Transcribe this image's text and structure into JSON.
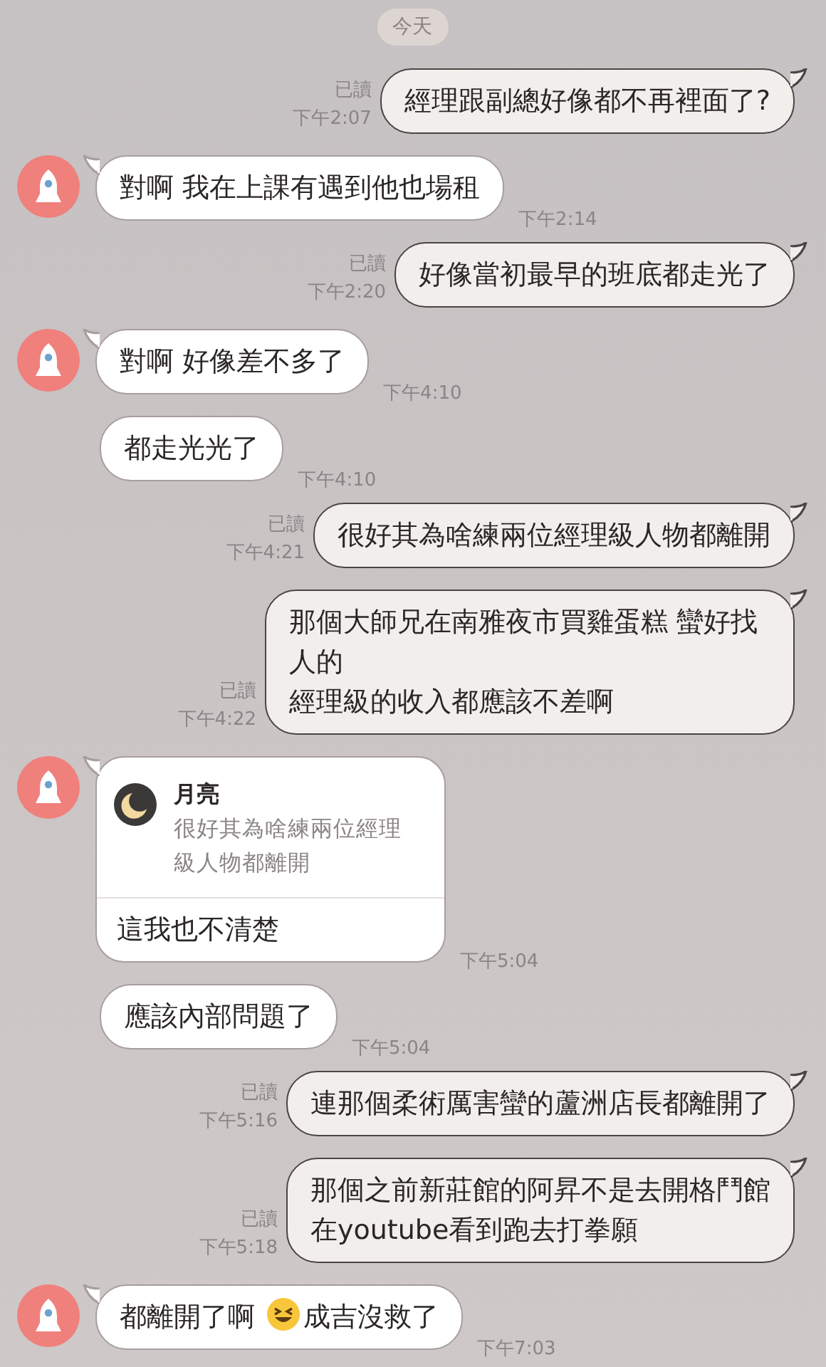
{
  "date_label": "今天",
  "messages": [
    {
      "kind": "sent",
      "read_label": "已讀",
      "time": "下午2:07",
      "lines": [
        "經理跟副總好像都不再裡面了?"
      ]
    },
    {
      "kind": "received",
      "avatar": true,
      "time": "下午2:14",
      "lines": [
        "對啊 我在上課有遇到他也場租"
      ]
    },
    {
      "kind": "sent",
      "read_label": "已讀",
      "time": "下午2:20",
      "lines": [
        "好像當初最早的班底都走光了"
      ]
    },
    {
      "kind": "received",
      "avatar": true,
      "time": "下午4:10",
      "lines": [
        "對啊 好像差不多了"
      ]
    },
    {
      "kind": "received",
      "avatar": false,
      "time": "下午4:10",
      "lines": [
        "都走光光了"
      ]
    },
    {
      "kind": "sent",
      "read_label": "已讀",
      "time": "下午4:21",
      "lines": [
        "很好其為啥練兩位經理級人物都離開"
      ]
    },
    {
      "kind": "sent",
      "read_label": "已讀",
      "time": "下午4:22",
      "lines": [
        "那個大師兄在南雅夜市買雞蛋糕 蠻好找人的",
        "經理級的收入都應該不差啊"
      ]
    },
    {
      "kind": "reply",
      "avatar": true,
      "time": "下午5:04",
      "quote_author": "月亮",
      "quote_text": "很好其為啥練兩位經理級人物都離開",
      "lines": [
        "這我也不清楚"
      ]
    },
    {
      "kind": "received",
      "avatar": false,
      "time": "下午5:04",
      "lines": [
        "應該內部問題了"
      ]
    },
    {
      "kind": "sent",
      "read_label": "已讀",
      "time": "下午5:16",
      "lines": [
        "連那個柔術厲害蠻的蘆洲店長都離開了"
      ]
    },
    {
      "kind": "sent",
      "read_label": "已讀",
      "time": "下午5:18",
      "lines": [
        "那個之前新莊館的阿昇不是去開格鬥館",
        "在youtube看到跑去打拳願"
      ]
    },
    {
      "kind": "received",
      "avatar": true,
      "time": "下午7:03",
      "segments": [
        {
          "kind": "text",
          "text": "都離開了啊 "
        },
        {
          "kind": "emoji"
        },
        {
          "kind": "text",
          "text": "成吉沒救了"
        }
      ]
    }
  ]
}
